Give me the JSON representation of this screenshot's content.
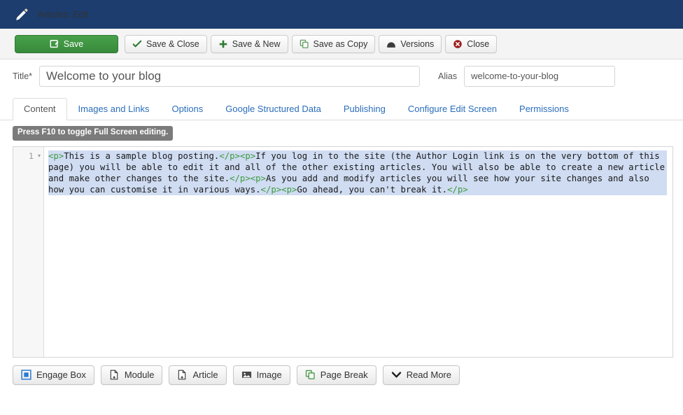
{
  "header": {
    "title": "Articles: Edit",
    "icon": "pencil-icon",
    "bg_color": "#1c3d6e"
  },
  "toolbar": {
    "buttons": [
      {
        "label": "Save",
        "icon": "save-disk-icon",
        "style": "primary",
        "accent": "#3f9442"
      },
      {
        "label": "Save & Close",
        "icon": "check-icon",
        "accent": "#2f7a33"
      },
      {
        "label": "Save & New",
        "icon": "plus-icon",
        "accent": "#2f7a33"
      },
      {
        "label": "Save as Copy",
        "icon": "copy-icon",
        "accent": "#4a8a4a"
      },
      {
        "label": "Versions",
        "icon": "archive-icon",
        "accent": "#444444"
      },
      {
        "label": "Close",
        "icon": "close-circle-icon",
        "accent": "#9c1f1f"
      }
    ]
  },
  "fields": {
    "title": {
      "label": "Title",
      "required_mark": "*",
      "value": "Welcome to your blog",
      "placeholder": "Title"
    },
    "alias": {
      "label": "Alias",
      "value": "welcome-to-your-blog",
      "placeholder": "Alias"
    }
  },
  "tabs": [
    {
      "label": "Content",
      "active": true
    },
    {
      "label": "Images and Links",
      "active": false
    },
    {
      "label": "Options",
      "active": false
    },
    {
      "label": "Google Structured Data",
      "active": false
    },
    {
      "label": "Publishing",
      "active": false
    },
    {
      "label": "Configure Edit Screen",
      "active": false
    },
    {
      "label": "Permissions",
      "active": false
    }
  ],
  "editor": {
    "fullscreen_note": "Press F10 to toggle Full Screen editing.",
    "line_number": "1",
    "fold_arrow": "▾",
    "selection_color": "#cfdcf2",
    "tag_color": "#3e9a3e",
    "code_segments": [
      {
        "t": "tag",
        "s": "<p>"
      },
      {
        "t": "text",
        "s": "This is a sample blog posting."
      },
      {
        "t": "tag",
        "s": "</p><p>"
      },
      {
        "t": "text",
        "s": "If you log in to the site (the Author Login link is on the very bottom of this page) you will be able to edit it and all of the other existing articles. You will also be able to create a new article and make other changes to the site."
      },
      {
        "t": "tag",
        "s": "</p><p>"
      },
      {
        "t": "text",
        "s": "As you add and modify articles you will see how your site changes and also how you can customise it in various ways."
      },
      {
        "t": "tag",
        "s": "</p><p>"
      },
      {
        "t": "text",
        "s": "Go ahead, you can't break it."
      },
      {
        "t": "tag",
        "s": "</p>"
      }
    ]
  },
  "editor_buttons": [
    {
      "label": "Engage Box",
      "icon": "engage-box-icon"
    },
    {
      "label": "Module",
      "icon": "module-page-icon"
    },
    {
      "label": "Article",
      "icon": "article-page-icon"
    },
    {
      "label": "Image",
      "icon": "image-icon"
    },
    {
      "label": "Page Break",
      "icon": "page-break-icon"
    },
    {
      "label": "Read More",
      "icon": "chevron-down-icon"
    }
  ]
}
